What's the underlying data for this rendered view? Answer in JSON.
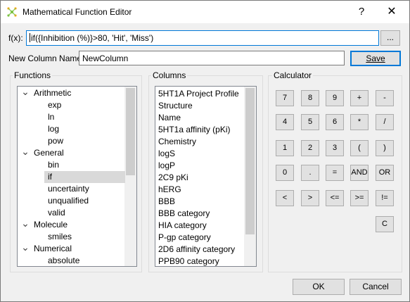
{
  "window": {
    "title": "Mathematical Function Editor",
    "help_label": "?",
    "close_label": "✕"
  },
  "formula": {
    "label": "f(x):",
    "value": "if({Inhibition (%)}>80, 'Hit', 'Miss')",
    "browse_label": "..."
  },
  "new_column": {
    "label": "New Column Name:",
    "value": "NewColumn",
    "save_label": "Save"
  },
  "functions": {
    "title": "Functions",
    "tree": [
      {
        "label": "Arithmetic",
        "kind": "group"
      },
      {
        "label": "exp",
        "kind": "item"
      },
      {
        "label": "ln",
        "kind": "item"
      },
      {
        "label": "log",
        "kind": "item"
      },
      {
        "label": "pow",
        "kind": "item"
      },
      {
        "label": "General",
        "kind": "group"
      },
      {
        "label": "bin",
        "kind": "item"
      },
      {
        "label": "if",
        "kind": "item",
        "selected": true
      },
      {
        "label": "uncertainty",
        "kind": "item"
      },
      {
        "label": "unqualified",
        "kind": "item"
      },
      {
        "label": "valid",
        "kind": "item"
      },
      {
        "label": "Molecule",
        "kind": "group"
      },
      {
        "label": "smiles",
        "kind": "item"
      },
      {
        "label": "Numerical",
        "kind": "group"
      },
      {
        "label": "absolute",
        "kind": "item"
      }
    ]
  },
  "columns": {
    "title": "Columns",
    "items": [
      "5HT1A Project Profile",
      "Structure",
      "Name",
      "5HT1a affinity (pKi)",
      "Chemistry",
      "logS",
      "logP",
      "2C9 pKi",
      "hERG",
      "BBB",
      "BBB category",
      "HIA category",
      "P-gp category",
      "2D6 affinity category",
      "PPB90 category"
    ]
  },
  "calculator": {
    "title": "Calculator",
    "rows": [
      [
        "7",
        "8",
        "9",
        "+",
        "-"
      ],
      [
        "4",
        "5",
        "6",
        "*",
        "/"
      ],
      [
        "1",
        "2",
        "3",
        "(",
        ")"
      ],
      [
        "0",
        ".",
        "=",
        "AND",
        "OR"
      ],
      [
        "<",
        ">",
        "<=",
        ">=",
        "!="
      ],
      [
        "",
        "",
        "",
        "",
        "C"
      ]
    ]
  },
  "footer": {
    "ok_label": "OK",
    "cancel_label": "Cancel"
  }
}
